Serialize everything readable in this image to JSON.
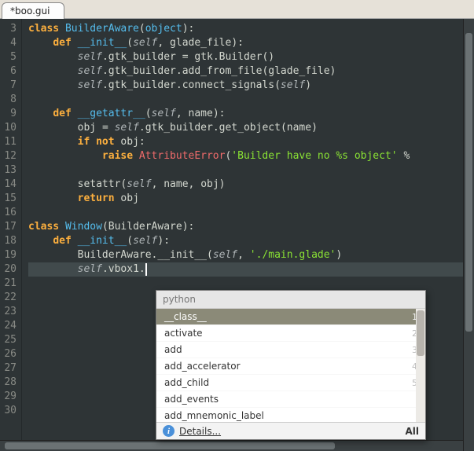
{
  "tab": {
    "title": "*boo.gui"
  },
  "gutter": {
    "start": 3,
    "end": 30
  },
  "code": {
    "lines": [
      {
        "indent": 0,
        "tokens": [
          [
            "kw",
            "class "
          ],
          [
            "def",
            "BuilderAware"
          ],
          [
            "paren",
            "("
          ],
          [
            "builtin",
            "object"
          ],
          [
            "paren",
            "):"
          ]
        ]
      },
      {
        "indent": 1,
        "tokens": [
          [
            "kw",
            "def "
          ],
          [
            "fn",
            "__init__"
          ],
          [
            "paren",
            "("
          ],
          [
            "self",
            "self"
          ],
          [
            "op",
            ", "
          ],
          [
            "id",
            "glade_file"
          ],
          [
            "paren",
            "):"
          ]
        ]
      },
      {
        "indent": 2,
        "tokens": [
          [
            "self",
            "self"
          ],
          [
            "op",
            "."
          ],
          [
            "id",
            "gtk_builder "
          ],
          [
            "op",
            "= "
          ],
          [
            "id",
            "gtk"
          ],
          [
            "op",
            "."
          ],
          [
            "id",
            "Builder"
          ],
          [
            "paren",
            "()"
          ]
        ]
      },
      {
        "indent": 2,
        "tokens": [
          [
            "self",
            "self"
          ],
          [
            "op",
            "."
          ],
          [
            "id",
            "gtk_builder"
          ],
          [
            "op",
            "."
          ],
          [
            "id",
            "add_from_file"
          ],
          [
            "paren",
            "("
          ],
          [
            "id",
            "glade_file"
          ],
          [
            "paren",
            ")"
          ]
        ]
      },
      {
        "indent": 2,
        "tokens": [
          [
            "self",
            "self"
          ],
          [
            "op",
            "."
          ],
          [
            "id",
            "gtk_builder"
          ],
          [
            "op",
            "."
          ],
          [
            "id",
            "connect_signals"
          ],
          [
            "paren",
            "("
          ],
          [
            "self",
            "self"
          ],
          [
            "paren",
            ")"
          ]
        ]
      },
      {
        "indent": 0,
        "tokens": []
      },
      {
        "indent": 1,
        "tokens": [
          [
            "kw",
            "def "
          ],
          [
            "fn",
            "__getattr__"
          ],
          [
            "paren",
            "("
          ],
          [
            "self",
            "self"
          ],
          [
            "op",
            ", "
          ],
          [
            "id",
            "name"
          ],
          [
            "paren",
            "):"
          ]
        ]
      },
      {
        "indent": 2,
        "tokens": [
          [
            "id",
            "obj "
          ],
          [
            "op",
            "= "
          ],
          [
            "self",
            "self"
          ],
          [
            "op",
            "."
          ],
          [
            "id",
            "gtk_builder"
          ],
          [
            "op",
            "."
          ],
          [
            "id",
            "get_object"
          ],
          [
            "paren",
            "("
          ],
          [
            "id",
            "name"
          ],
          [
            "paren",
            ")"
          ]
        ]
      },
      {
        "indent": 2,
        "tokens": [
          [
            "kw",
            "if not "
          ],
          [
            "id",
            "obj"
          ],
          [
            "op",
            ":"
          ]
        ]
      },
      {
        "indent": 3,
        "tokens": [
          [
            "kw",
            "raise "
          ],
          [
            "err",
            "AttributeError"
          ],
          [
            "paren",
            "("
          ],
          [
            "str",
            "'Builder have no %s object'"
          ],
          [
            "op",
            " %"
          ]
        ]
      },
      {
        "indent": 0,
        "tokens": []
      },
      {
        "indent": 2,
        "tokens": [
          [
            "id",
            "setattr"
          ],
          [
            "paren",
            "("
          ],
          [
            "self",
            "self"
          ],
          [
            "op",
            ", "
          ],
          [
            "id",
            "name"
          ],
          [
            "op",
            ", "
          ],
          [
            "id",
            "obj"
          ],
          [
            "paren",
            ")"
          ]
        ]
      },
      {
        "indent": 2,
        "tokens": [
          [
            "kw",
            "return "
          ],
          [
            "id",
            "obj"
          ]
        ]
      },
      {
        "indent": 0,
        "tokens": []
      },
      {
        "indent": 0,
        "tokens": [
          [
            "kw",
            "class "
          ],
          [
            "def",
            "Window"
          ],
          [
            "paren",
            "("
          ],
          [
            "id",
            "BuilderAware"
          ],
          [
            "paren",
            "):"
          ]
        ]
      },
      {
        "indent": 1,
        "tokens": [
          [
            "kw",
            "def "
          ],
          [
            "fn",
            "__init__"
          ],
          [
            "paren",
            "("
          ],
          [
            "self",
            "self"
          ],
          [
            "paren",
            "):"
          ]
        ]
      },
      {
        "indent": 2,
        "tokens": [
          [
            "id",
            "BuilderAware"
          ],
          [
            "op",
            "."
          ],
          [
            "id",
            "__init__"
          ],
          [
            "paren",
            "("
          ],
          [
            "self",
            "self"
          ],
          [
            "op",
            ", "
          ],
          [
            "str",
            "'./main.glade'"
          ],
          [
            "paren",
            ")"
          ]
        ]
      },
      {
        "indent": 2,
        "hl": true,
        "cursor": true,
        "tokens": [
          [
            "self",
            "self"
          ],
          [
            "op",
            "."
          ],
          [
            "id",
            "vbox1"
          ],
          [
            "op",
            "."
          ]
        ]
      },
      {
        "indent": 0,
        "tokens": []
      },
      {
        "indent": 0,
        "tokens": []
      },
      {
        "indent": 0,
        "tokens": []
      },
      {
        "indent": 0,
        "tokens": []
      },
      {
        "indent": 0,
        "tokens": []
      },
      {
        "indent": 0,
        "tokens": []
      },
      {
        "indent": 0,
        "tokens": []
      },
      {
        "indent": 0,
        "tokens": []
      },
      {
        "indent": 0,
        "tokens": []
      },
      {
        "indent": 0,
        "tokens": []
      }
    ]
  },
  "completion": {
    "type_hint": "python",
    "items": [
      {
        "label": "__class__",
        "rank": "1",
        "selected": true
      },
      {
        "label": "activate",
        "rank": "2"
      },
      {
        "label": "add",
        "rank": "3"
      },
      {
        "label": "add_accelerator",
        "rank": "4"
      },
      {
        "label": "add_child",
        "rank": "5"
      },
      {
        "label": "add_events",
        "rank": ""
      },
      {
        "label": "add_mnemonic_label",
        "rank": ""
      }
    ],
    "details_label": "Details...",
    "all_label": "All"
  }
}
